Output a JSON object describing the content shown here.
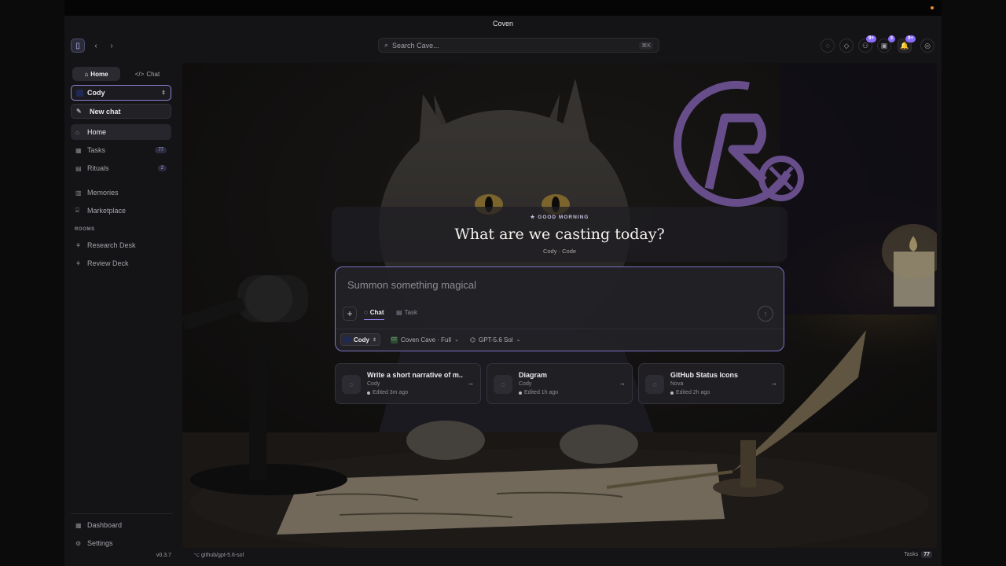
{
  "window": {
    "title": "Coven"
  },
  "search": {
    "placeholder": "Search Cave...",
    "shortcut": "⌘K"
  },
  "toolbar_badges": {
    "b1": "9+",
    "b2": "3",
    "b3": "9+"
  },
  "sidebar": {
    "switch": [
      {
        "label": "Home",
        "icon": "⌂"
      },
      {
        "label": "Chat",
        "icon": "</>"
      }
    ],
    "agent": "Cody",
    "new_chat": "New chat",
    "nav": [
      {
        "label": "Home",
        "icon": "home-icon",
        "count": ""
      },
      {
        "label": "Tasks",
        "icon": "tasks-icon",
        "count": "77"
      },
      {
        "label": "Rituals",
        "icon": "rituals-icon",
        "count": "2"
      },
      {
        "label": "Memories",
        "icon": "memories-icon",
        "count": ""
      },
      {
        "label": "Marketplace",
        "icon": "marketplace-icon",
        "count": ""
      }
    ],
    "rooms_header": "ROOMS",
    "rooms": [
      {
        "label": "Research Desk"
      },
      {
        "label": "Review Deck"
      }
    ],
    "bottom": [
      {
        "label": "Dashboard"
      },
      {
        "label": "Settings"
      }
    ],
    "version": "v0.3.7"
  },
  "main": {
    "greeting": "GOOD MORNING",
    "headline": "What are we casting today?",
    "subtitle": "Cody · Code",
    "composer": {
      "placeholder": "Summon something magical",
      "modes": [
        "Chat",
        "Task"
      ],
      "agent": "Cody",
      "workspace": "Coven Cave · Full",
      "workspace_badge": "CC",
      "model": "GPT-5.6 Sol"
    },
    "recent": [
      {
        "title": "Write a short narrative of m...",
        "author": "Cody",
        "edited": "Edited 3m ago"
      },
      {
        "title": "Diagram",
        "author": "Cody",
        "edited": "Edited 1h ago"
      },
      {
        "title": "GitHub Status Icons",
        "author": "Nova",
        "edited": "Edited 2h ago"
      }
    ]
  },
  "statusbar": {
    "branch": "github/gpt-5.6-sol",
    "tasks_label": "Tasks",
    "tasks_count": "77"
  },
  "colors": {
    "accent": "#8f7fe6",
    "background": "#141416",
    "logo": "#a77ee0"
  }
}
